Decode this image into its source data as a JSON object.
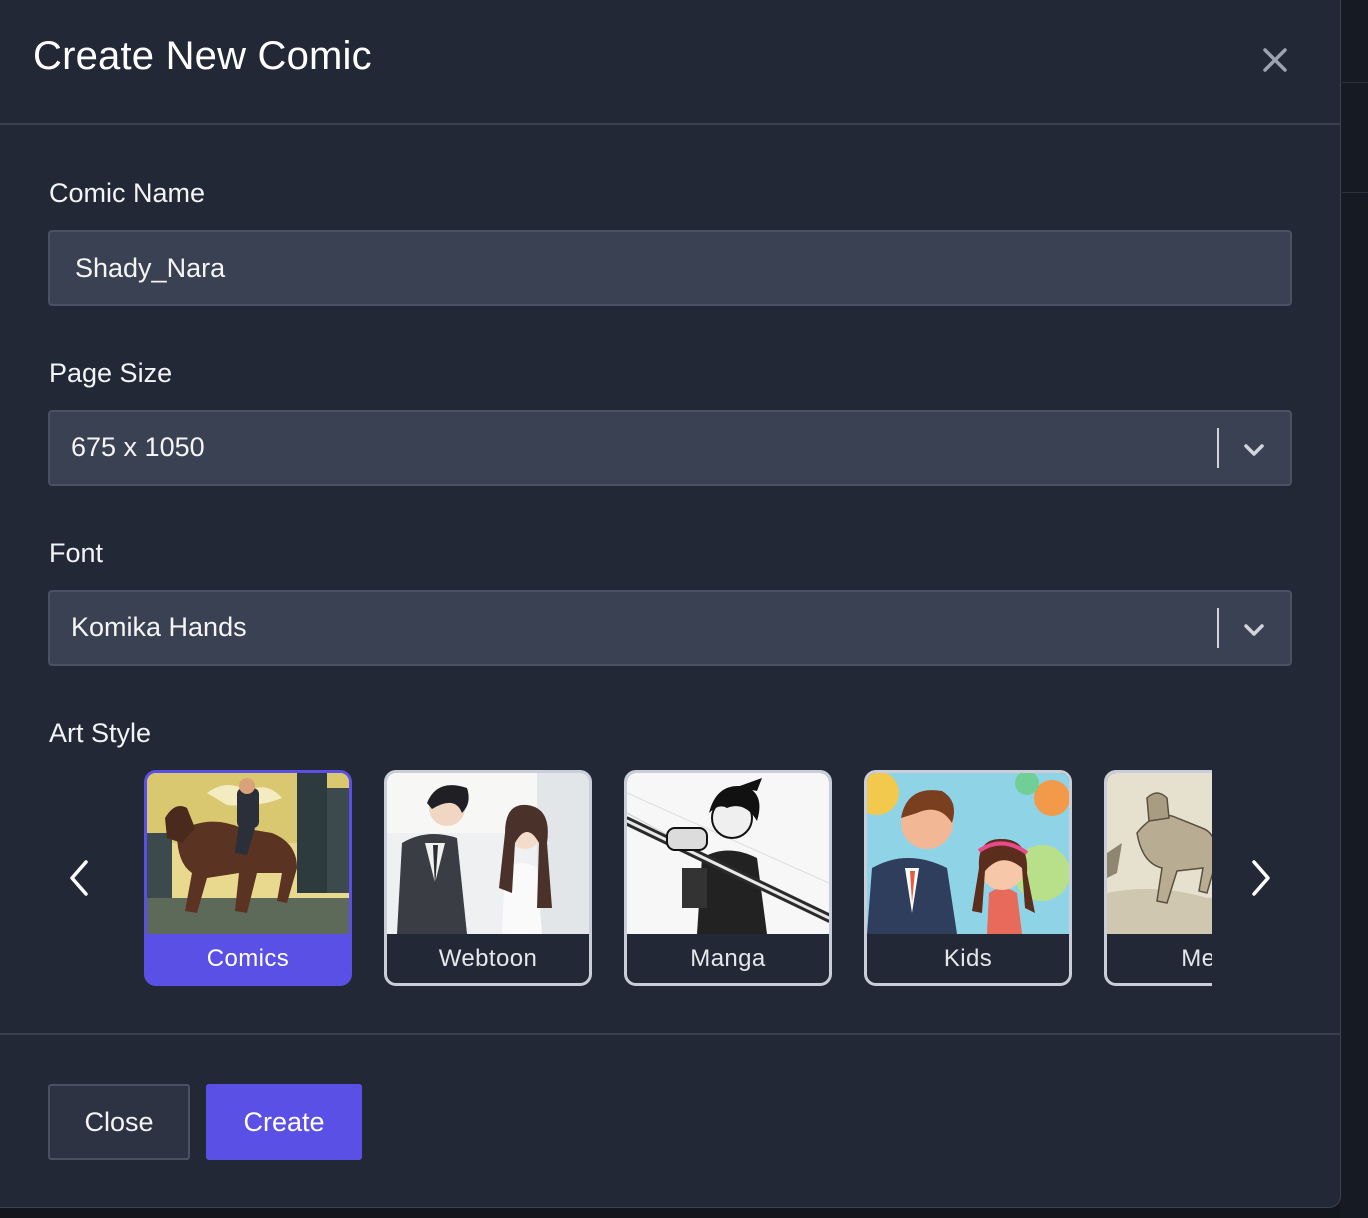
{
  "modal": {
    "title": "Create New Comic",
    "close_icon": "close-icon"
  },
  "form": {
    "comic_name": {
      "label": "Comic Name",
      "value": "Shady_Nara"
    },
    "page_size": {
      "label": "Page Size",
      "value": "675 x 1050"
    },
    "font": {
      "label": "Font",
      "value": "Komika Hands"
    },
    "art_style": {
      "label": "Art Style",
      "selected": "Comics",
      "options": [
        {
          "label": "Comics",
          "thumbnail": "comics-horse-rider-thumbnail"
        },
        {
          "label": "Webtoon",
          "thumbnail": "webtoon-couple-thumbnail"
        },
        {
          "label": "Manga",
          "thumbnail": "manga-swordsman-thumbnail"
        },
        {
          "label": "Kids",
          "thumbnail": "kids-cartoon-thumbnail"
        },
        {
          "label": "Medi",
          "thumbnail": "medieval-engraving-thumbnail"
        }
      ],
      "prev_icon": "chevron-left-icon",
      "next_icon": "chevron-right-icon"
    }
  },
  "footer": {
    "close_label": "Close",
    "create_label": "Create"
  },
  "colors": {
    "accent": "#5b50e6",
    "modal_bg": "#222836",
    "input_bg": "#3a4152"
  }
}
